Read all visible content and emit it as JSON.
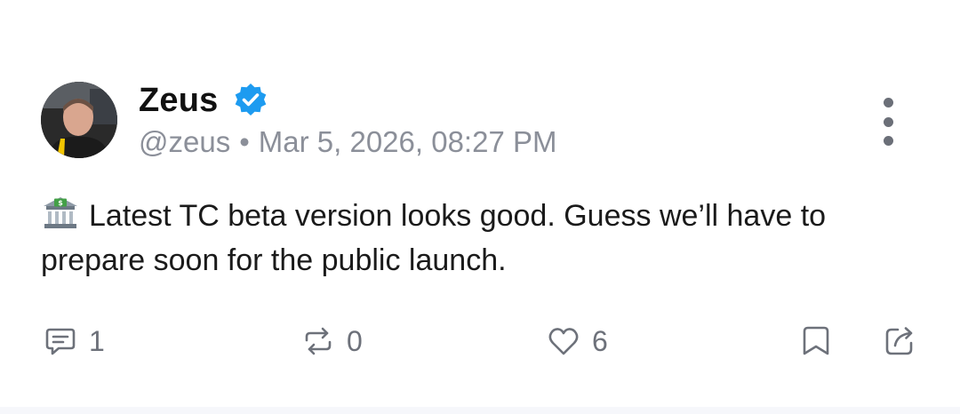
{
  "post": {
    "author": {
      "display_name": "Zeus",
      "handle": "@zeus",
      "verified_icon": "verified-badge-icon",
      "avatar_icon": "avatar-photo"
    },
    "separator": "•",
    "timestamp": "Mar 5, 2026, 08:27 PM",
    "text": "Latest TC beta version looks good. Guess we’ll have to prepare soon for the public launch.",
    "leading_emoji": "bank-icon",
    "actions": {
      "reply_count": "1",
      "repost_count": "0",
      "like_count": "6"
    }
  },
  "colors": {
    "verified": "#1d9bf0",
    "meta_text": "#8b8f99",
    "icon": "#6d717a"
  }
}
